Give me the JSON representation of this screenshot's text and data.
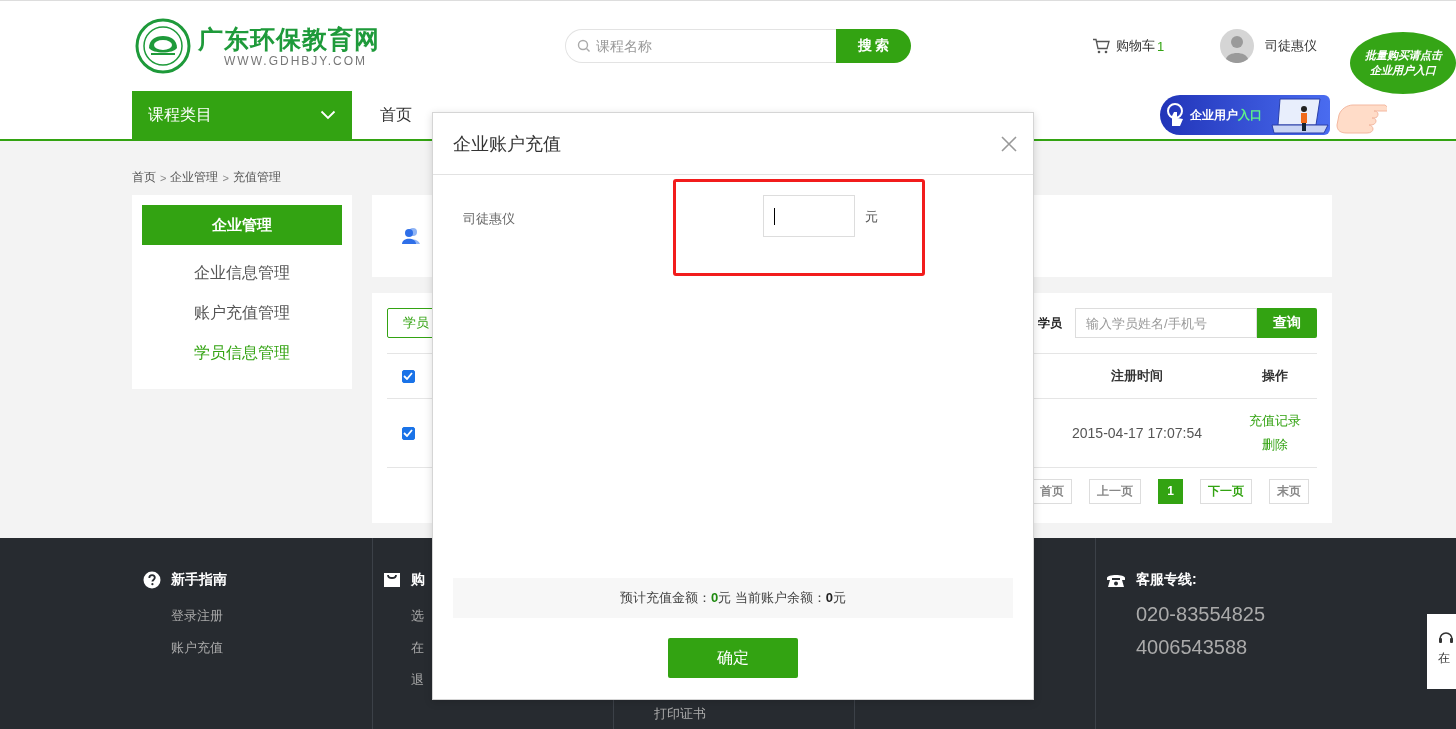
{
  "header": {
    "logo": {
      "title": "广东环保教育网",
      "url": "WWW.GDHBJY.COM"
    },
    "search": {
      "placeholder": "课程名称",
      "button": "搜 索"
    },
    "cart": {
      "label": "购物车",
      "count": "1"
    },
    "user": {
      "name": "司徒惠仪"
    },
    "promo": {
      "bubble_lines": [
        "批量购买请点击",
        "企业用户入口"
      ],
      "banner": {
        "label": "企业用户",
        "highlight": "入口"
      }
    }
  },
  "nav": {
    "category": "课程类目",
    "items": [
      "首页"
    ]
  },
  "breadcrumb": {
    "separator": ">",
    "items": [
      "首页",
      "企业管理",
      "充值管理"
    ]
  },
  "sidebar": {
    "title": "企业管理",
    "items": [
      {
        "label": "企业信息管理",
        "selected": false
      },
      {
        "label": "账户充值管理",
        "selected": false
      },
      {
        "label": "学员信息管理",
        "selected": true
      }
    ]
  },
  "students": {
    "tab_button": "学员",
    "search_label": "学员",
    "search_placeholder": "输入学员姓名/手机号",
    "search_button": "查询",
    "header_checked": true,
    "columns": [
      "注册时间",
      "操作"
    ],
    "rows": [
      {
        "checked": true,
        "registered": "2015-04-17 17:07:54",
        "actions": [
          "充值记录",
          "删除"
        ]
      }
    ],
    "pagination": [
      {
        "label": "首页",
        "selected": false,
        "disabled": true
      },
      {
        "label": "上一页",
        "selected": false,
        "disabled": true
      },
      {
        "label": "1",
        "selected": true,
        "disabled": false
      },
      {
        "label": "下一页",
        "selected": false,
        "disabled": false
      },
      {
        "label": "末页",
        "selected": false,
        "disabled": true
      }
    ]
  },
  "footer": {
    "columns": [
      {
        "kind": "links",
        "title": "新手指南",
        "links": [
          "登录注册",
          "账户充值"
        ]
      },
      {
        "kind": "links",
        "title": "购",
        "links": [
          "选",
          "在",
          "退"
        ]
      },
      {
        "kind": "lower",
        "links": [
          "打印证书"
        ]
      },
      {
        "kind": "blank"
      },
      {
        "kind": "contact",
        "title": "客服专线:",
        "phones": [
          "020-83554825",
          "4006543588"
        ]
      }
    ]
  },
  "side_widget": {
    "label": "在"
  },
  "modal": {
    "title": "企业账户充值",
    "rows": [
      {
        "name": "司徒惠仪",
        "unit": "元",
        "highlighted": true
      }
    ],
    "summary": "预计充值金额：**0**元 当前账户余额：**0**元",
    "confirm": "确定"
  }
}
